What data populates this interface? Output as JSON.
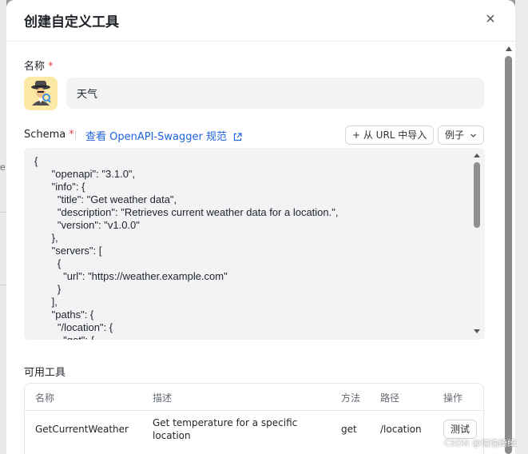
{
  "dialog": {
    "title": "创建自定义工具",
    "close_icon": "×"
  },
  "name_field": {
    "label": "名称",
    "required_mark": "*",
    "value": "天气",
    "avatar_icon": "detective-icon"
  },
  "schema": {
    "label": "Schema",
    "required_mark": "*",
    "swagger_link": "查看 OpenAPI-Swagger 规范",
    "import_url_button": "+ 从 URL 中导入",
    "example_button": "例子",
    "code": "{\n      \"openapi\": \"3.1.0\",\n      \"info\": {\n        \"title\": \"Get weather data\",\n        \"description\": \"Retrieves current weather data for a location.\",\n        \"version\": \"v1.0.0\"\n      },\n      \"servers\": [\n        {\n          \"url\": \"https://weather.example.com\"\n        }\n      ],\n      \"paths\": {\n        \"/location\": {\n          \"get\": {"
  },
  "tools": {
    "label": "可用工具",
    "columns": [
      "名称",
      "描述",
      "方法",
      "路径",
      "操作"
    ],
    "rows": [
      {
        "name": "GetCurrentWeather",
        "description": "Get temperature for a specific location",
        "method": "get",
        "path": "/location",
        "action": "测试"
      }
    ]
  },
  "watermark": "CSDN @瑞瑞绮绮"
}
